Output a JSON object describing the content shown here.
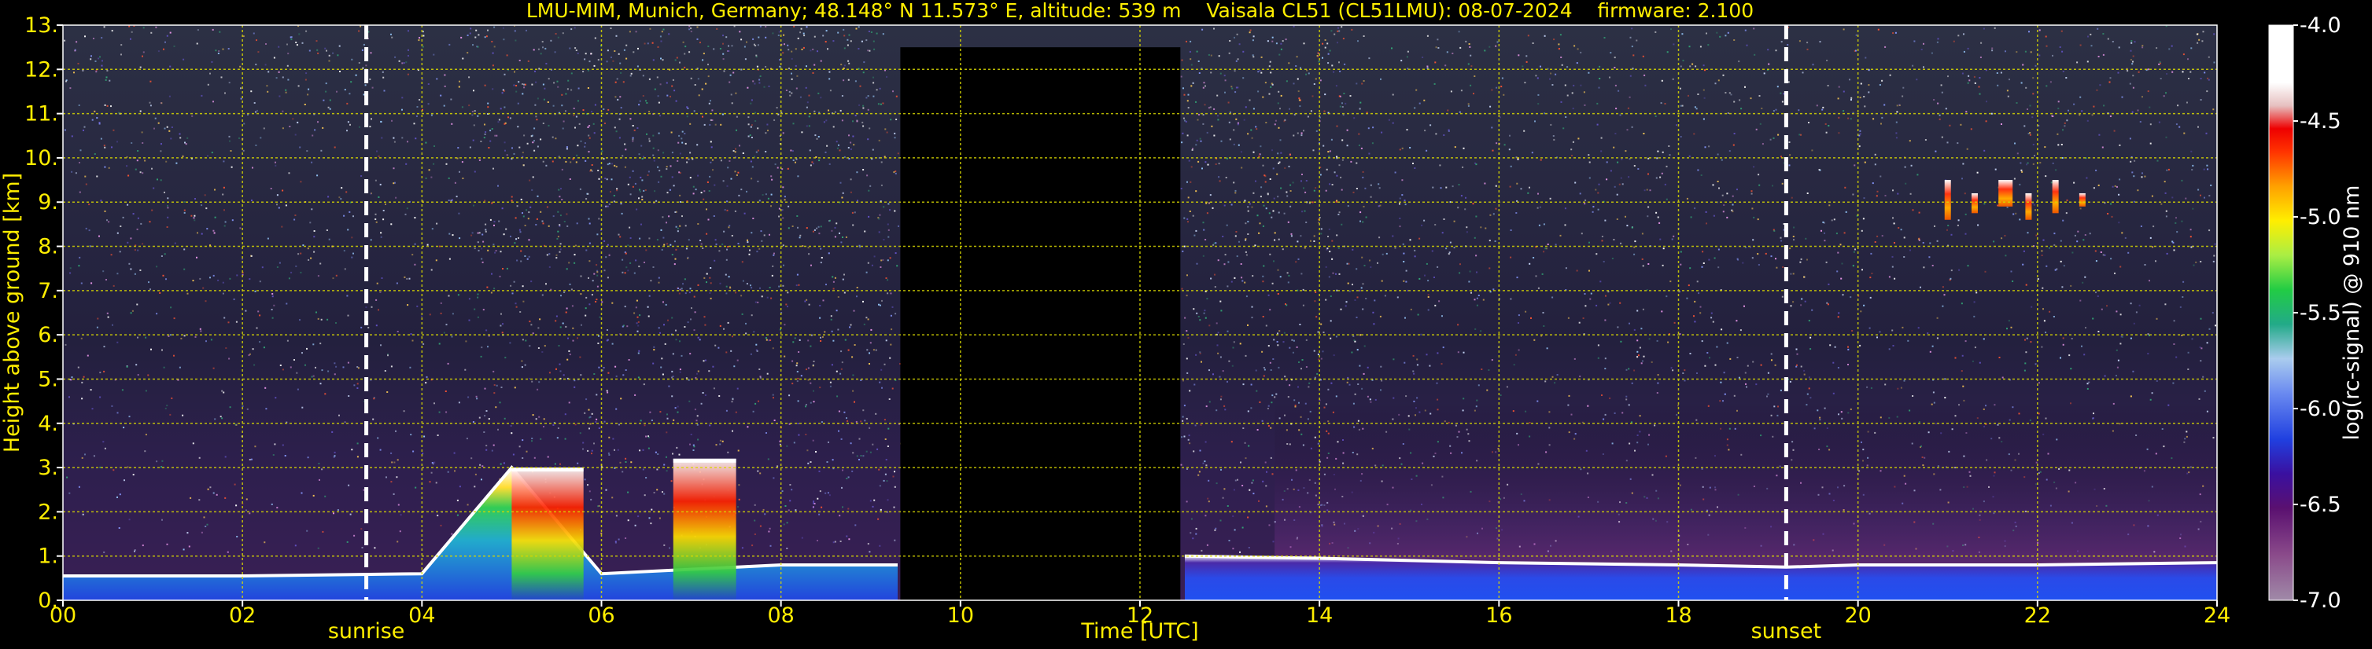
{
  "chart_data": {
    "type": "heatmap",
    "title": "LMU-MIM, Munich, Germany; 48.148° N 11.573° E, altitude: 539 m    Vaisala CL51 (CL51LMU): 08-07-2024    firmware: 2.100",
    "xlabel": "Time [UTC]",
    "ylabel": "Height above ground [km]",
    "xlim": [
      0,
      24
    ],
    "ylim": [
      0,
      13
    ],
    "x_ticks": [
      "00",
      "02",
      "04",
      "06",
      "08",
      "10",
      "12",
      "14",
      "16",
      "18",
      "20",
      "22",
      "24"
    ],
    "y_ticks": [
      "0.",
      "1.",
      "2.",
      "3.",
      "4.",
      "5.",
      "6.",
      "7.",
      "8.",
      "9.",
      "10.",
      "11.",
      "12.",
      "13."
    ],
    "grid": true,
    "colorbar": {
      "label": "log(rc-signal) @ 910 nm",
      "range": [
        -7.0,
        -4.0
      ],
      "ticks": [
        "-4.0",
        "-4.5",
        "-5.0",
        "-5.5",
        "-6.0",
        "-6.5",
        "-7.0"
      ]
    },
    "events": [
      {
        "label": "sunrise",
        "time": 3.38
      },
      {
        "label": "sunset",
        "time": 19.2
      }
    ],
    "data_gaps": [
      [
        9.33,
        12.45
      ]
    ],
    "features": [
      {
        "name": "boundary layer top",
        "x": [
          0,
          2,
          4,
          5,
          6,
          8,
          9.3,
          12.5,
          14,
          16,
          18,
          19.2,
          20,
          22,
          24
        ],
        "y": [
          0.55,
          0.55,
          0.6,
          3.0,
          0.6,
          0.8,
          0.8,
          1.0,
          0.95,
          0.85,
          0.8,
          0.75,
          0.8,
          0.8,
          0.85
        ]
      },
      {
        "name": "cloud layer",
        "x": [
          5.0,
          5.8
        ],
        "y": [
          2.6,
          3.0
        ]
      },
      {
        "name": "cloud layer",
        "x": [
          6.8,
          7.5
        ],
        "y": [
          2.2,
          3.2
        ]
      },
      {
        "name": "cirrus",
        "x": [
          21.0,
          22.5
        ],
        "y": [
          8.6,
          9.5
        ]
      }
    ]
  }
}
